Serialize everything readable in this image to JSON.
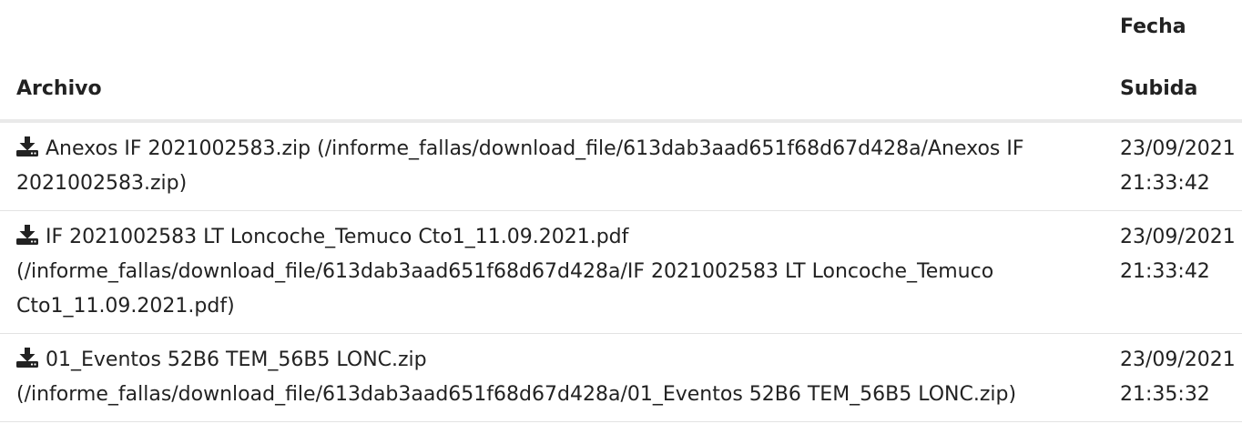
{
  "table": {
    "headers": {
      "archivo": "Archivo",
      "fecha_line1": "Fecha",
      "fecha_line2": "Subida"
    },
    "rows": [
      {
        "icon": "download-icon",
        "link_text": "Anexos IF 2021002583.zip (/informe_fallas/download_file/613dab3aad651f68d67d428a/Anexos IF 2021002583.zip)",
        "date": "23/09/2021",
        "time": "21:33:42"
      },
      {
        "icon": "download-icon",
        "link_text": "IF 2021002583 LT Loncoche_Temuco Cto1_11.09.2021.pdf (/informe_fallas/download_file/613dab3aad651f68d67d428a/IF 2021002583 LT Loncoche_Temuco Cto1_11.09.2021.pdf)",
        "date": "23/09/2021",
        "time": "21:33:42"
      },
      {
        "icon": "download-icon",
        "link_text": "01_Eventos 52B6 TEM_56B5 LONC.zip (/informe_fallas/download_file/613dab3aad651f68d67d428a/01_Eventos 52B6 TEM_56B5 LONC.zip)",
        "date": "23/09/2021",
        "time": "21:35:32"
      }
    ]
  }
}
